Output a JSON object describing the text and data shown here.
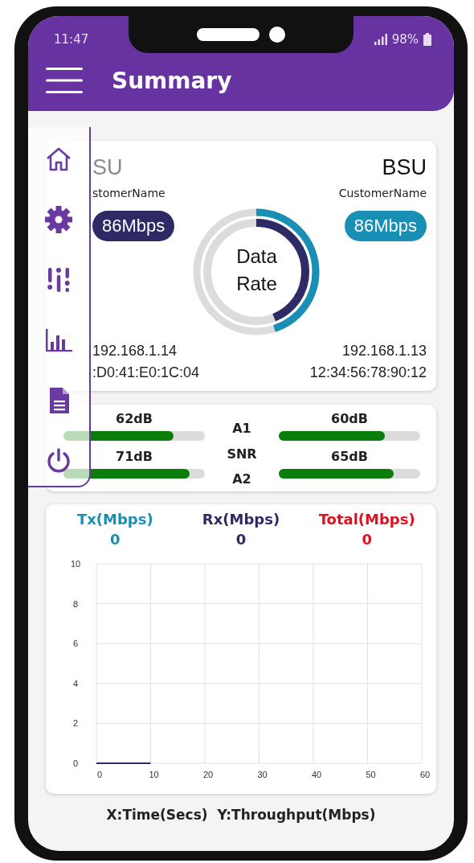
{
  "status_bar": {
    "time": "11:47",
    "battery": "98%"
  },
  "header": {
    "title": "Summary"
  },
  "units": [
    {
      "title": "SU",
      "customer": "stomerName",
      "rate": "86Mbps",
      "color": "#2d2a66",
      "ip": "192.168.1.14",
      "mac": ":D0:41:E0:1C:04"
    },
    {
      "title": "BSU",
      "customer": "CustomerName",
      "rate": "86Mbps",
      "color": "#1a8fb5",
      "ip": "192.168.1.13",
      "mac": "12:34:56:78:90:12"
    }
  ],
  "data_rate": {
    "label": "Data Rate",
    "rings": [
      {
        "color": "#1a8fb5",
        "level": 0.45
      },
      {
        "color": "#2d2a66",
        "level": 0.44
      }
    ]
  },
  "snr": {
    "labels": [
      "A1",
      "SNR",
      "A2"
    ],
    "sides": [
      [
        {
          "reading": "62dB",
          "level": 0.78
        },
        {
          "reading": "71dB",
          "level": 0.89
        }
      ],
      [
        {
          "reading": "60dB",
          "level": 0.75
        },
        {
          "reading": "65dB",
          "level": 0.81
        }
      ]
    ]
  },
  "throughput": {
    "stats": [
      {
        "label": "Tx(Mbps)",
        "value": "0",
        "color": "#1a8fb5"
      },
      {
        "label": "Rx(Mbps)",
        "value": "0",
        "color": "#2d2a66"
      },
      {
        "label": "Total(Mbps)",
        "value": "0",
        "color": "#e0101e"
      }
    ],
    "chart_data": {
      "type": "line",
      "x": [
        0,
        10
      ],
      "series": [
        {
          "color": "#2d2a66",
          "values": [
            0,
            0
          ]
        }
      ],
      "grid": true,
      "xlim": [
        0,
        60
      ],
      "ylim": [
        0,
        10
      ],
      "xticks": [
        0,
        10,
        20,
        30,
        40,
        50,
        60
      ],
      "yticks": [
        0,
        2,
        4,
        6,
        8,
        10
      ]
    },
    "caption": "X:Time(Secs)  Y:Throughput(Mbps)"
  }
}
